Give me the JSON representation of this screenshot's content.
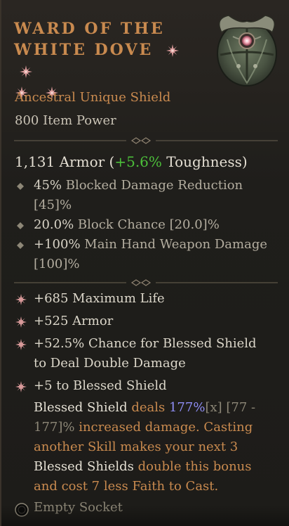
{
  "item": {
    "name_line1": "WARD OF THE",
    "name_line2": "WHITE DOVE",
    "subtype": "Ancestral Unique Shield",
    "item_power": "800 Item Power"
  },
  "armor": {
    "value": "1,131 Armor (",
    "toughness": "+5.6%",
    "suffix": " Toughness)"
  },
  "implicits": [
    {
      "num": "45%",
      "text": " Blocked Damage Reduction",
      "range": "[45]%"
    },
    {
      "num": "20.0%",
      "text": " Block Chance [20.0]%",
      "range": ""
    },
    {
      "num": "+100%",
      "text": " Main Hand Weapon Damage",
      "range": "[100]%"
    }
  ],
  "affixes": [
    {
      "text": "+685 Maximum Life"
    },
    {
      "text": "+525 Armor"
    },
    {
      "text": "+52.5% Chance for Blessed Shield to Deal Double Damage"
    },
    {
      "text": "+5 to Blessed Shield"
    }
  ],
  "aspect": {
    "p1": "Blessed Shield",
    "p2": " deals ",
    "p3": "177%",
    "p4": "[x] [77 - 177]%",
    "p5": " increased damage. Casting another Skill makes your next 3 ",
    "p6": "Blessed Shields",
    "p7": " double this bonus and cost 7 less Faith to Cast."
  },
  "socket": {
    "label": "Empty Socket"
  },
  "colors": {
    "title": "#c98a4f",
    "toughness": "#4cbf3a",
    "aspect_value": "#8f8ef5"
  }
}
